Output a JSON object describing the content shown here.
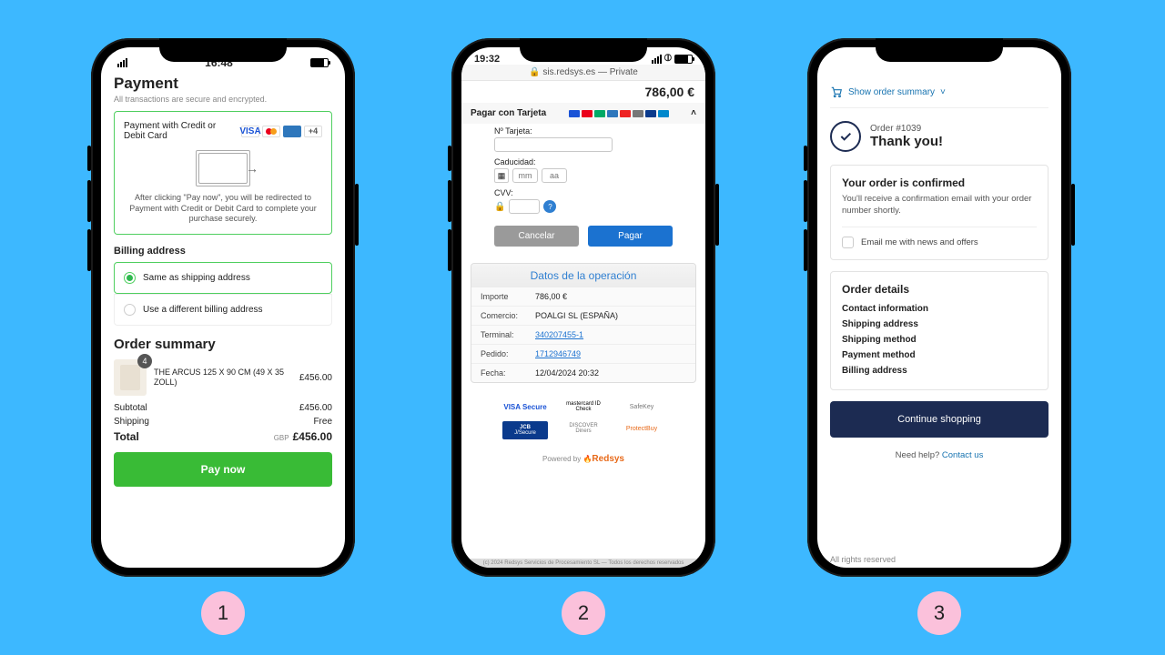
{
  "step_labels": [
    "1",
    "2",
    "3"
  ],
  "s1": {
    "status": {
      "time": "16:48"
    },
    "title": "Payment",
    "subtitle": "All transactions are secure and encrypted.",
    "pay_with": "Payment with Credit or Debit Card",
    "more_count": "+4",
    "redirect_note": "After clicking \"Pay now\", you will be redirected to Payment with Credit or Debit Card to complete your purchase securely.",
    "billing_heading": "Billing address",
    "billing_same": "Same as shipping address",
    "billing_diff": "Use a different billing address",
    "order_summary": "Order summary",
    "item": {
      "qty": "4",
      "name": "THE ARCUS 125 X 90 CM (49 X 35 ZOLL)",
      "price": "£456.00"
    },
    "subtotal_label": "Subtotal",
    "subtotal_value": "£456.00",
    "shipping_label": "Shipping",
    "shipping_value": "Free",
    "total_label": "Total",
    "total_currency": "GBP",
    "total_value": "£456.00",
    "pay_now": "Pay now"
  },
  "s2": {
    "status": {
      "time": "19:32"
    },
    "url": "🔒 sis.redsys.es — Private",
    "amount": "786,00 €",
    "pay_card": "Pagar con Tarjeta",
    "num_label": "Nº Tarjeta:",
    "exp_label": "Caducidad:",
    "exp_m": "mm",
    "exp_y": "aa",
    "cvv_label": "CVV:",
    "cancel": "Cancelar",
    "pay": "Pagar",
    "op_title": "Datos de la operación",
    "rows": [
      {
        "k": "Importe",
        "v": "786,00 €",
        "link": false
      },
      {
        "k": "Comercio:",
        "v": "POALGI SL (ESPAÑA)",
        "link": false
      },
      {
        "k": "Terminal:",
        "v": "340207455-1",
        "link": true
      },
      {
        "k": "Pedido:",
        "v": "1712946749",
        "link": true
      },
      {
        "k": "Fecha:",
        "v": "12/04/2024  20:32",
        "link": false
      }
    ],
    "logos": {
      "visa": "VISA\nSecure",
      "mc": "mastercard\nID Check",
      "safe": "SafeKey",
      "jcb_top": "JCB",
      "jcb_bot": "J/Secure",
      "dn": "DISCOVER\nDiners",
      "pb": "ProtectBuy"
    },
    "powered_prefix": "Powered by ",
    "powered_brand": "Redsys",
    "footer": "(c) 2024 Redsys Servicios de Procesamiento SL — Todos los derechos reservados"
  },
  "s3": {
    "toggle": "Show order summary",
    "order_num": "Order #1039",
    "thank": "Thank you!",
    "confirmed": "Your order is confirmed",
    "confirmed_body": "You'll receive a confirmation email with your order number shortly.",
    "news": "Email me with news and offers",
    "details_heading": "Order details",
    "details": [
      "Contact information",
      "Shipping address",
      "Shipping method",
      "Payment method",
      "Billing address"
    ],
    "continue": "Continue shopping",
    "help_prefix": "Need help? ",
    "help_link": "Contact us",
    "rights": "All rights reserved"
  }
}
